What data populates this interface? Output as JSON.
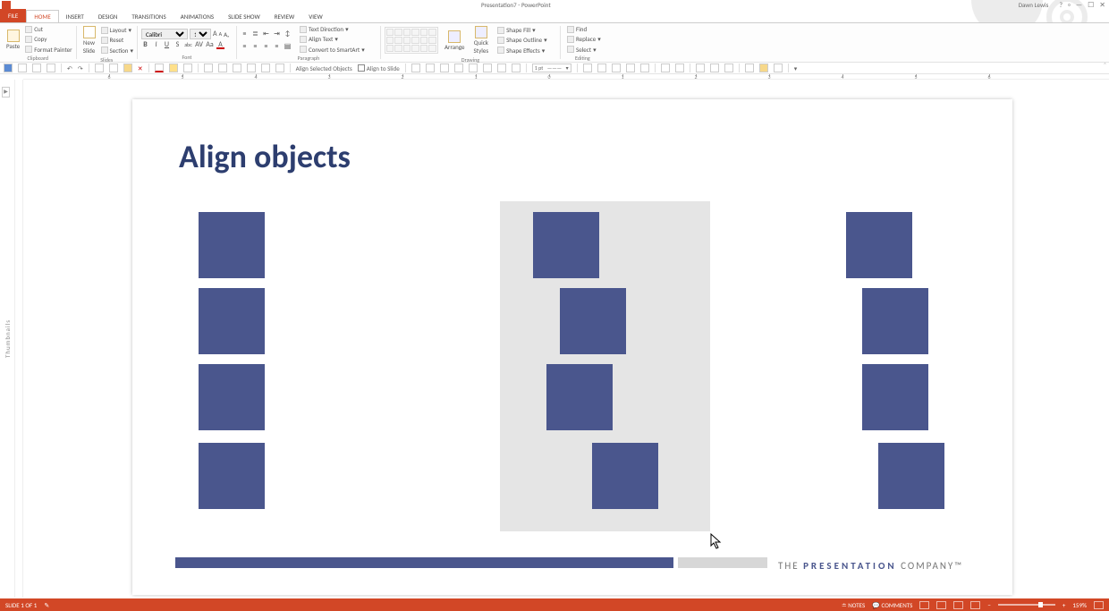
{
  "title": "Presentation7 - PowerPoint",
  "user": "Dawn Lewis",
  "help_icon": "?",
  "tabs": {
    "file": "FILE",
    "home": "HOME",
    "insert": "INSERT",
    "design": "DESIGN",
    "transitions": "TRANSITIONS",
    "animations": "ANIMATIONS",
    "slideshow": "SLIDE SHOW",
    "review": "REVIEW",
    "view": "VIEW"
  },
  "ribbon": {
    "clipboard": {
      "paste": "Paste",
      "cut": "Cut",
      "copy": "Copy",
      "format_painter": "Format Painter",
      "label": "Clipboard"
    },
    "slides": {
      "new_slide": "New\nSlide",
      "layout": "Layout",
      "reset": "Reset",
      "section": "Section",
      "label": "Slides"
    },
    "font": {
      "name": "Calibri",
      "size": "18",
      "label": "Font"
    },
    "paragraph": {
      "text_direction": "Text Direction",
      "align_text": "Align Text",
      "smartart": "Convert to SmartArt",
      "label": "Paragraph"
    },
    "drawing": {
      "arrange": "Arrange",
      "quick_styles": "Quick\nStyles",
      "shape_fill": "Shape Fill",
      "shape_outline": "Shape Outline",
      "shape_effects": "Shape Effects",
      "label": "Drawing"
    },
    "editing": {
      "find": "Find",
      "replace": "Replace",
      "select": "Select",
      "label": "Editing"
    }
  },
  "qat2": {
    "align_selected": "Align Selected Objects",
    "align_to_slide": "Align to Slide",
    "line_weight": "1 pt"
  },
  "ruler_h": [
    "6",
    "5",
    "4",
    "3",
    "2",
    "1",
    "0",
    "1",
    "2",
    "3",
    "4",
    "5",
    "6"
  ],
  "thumbnail_label": "Thumbnails",
  "slide": {
    "title": "Align objects",
    "logo_prefix": "THE ",
    "logo_bold": "PRESENTATION",
    "logo_suffix": " COMPANY™"
  },
  "status": {
    "slide_n": "SLIDE 1 OF 1",
    "lang_icon": "",
    "notes": "NOTES",
    "comments": "COMMENTS",
    "zoom": "159%"
  }
}
